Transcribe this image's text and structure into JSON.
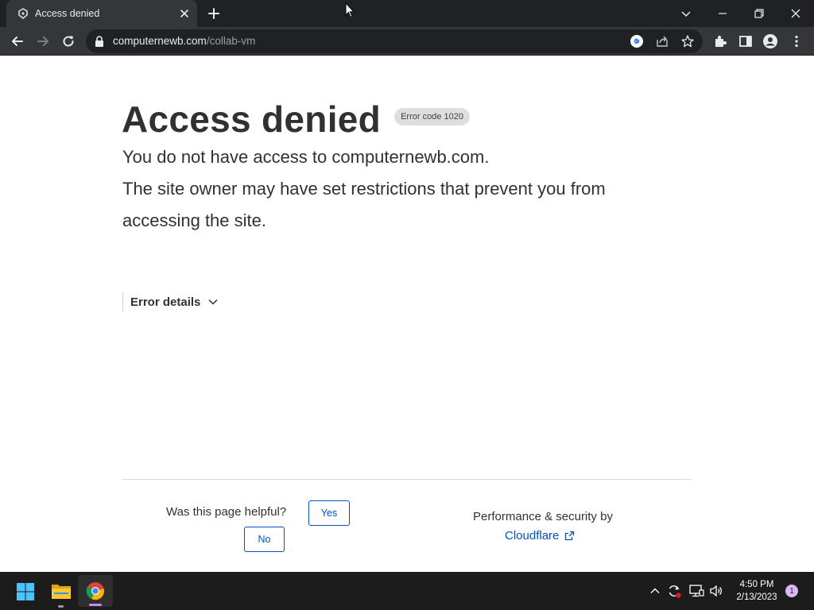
{
  "browser": {
    "tab": {
      "title": "Access denied"
    },
    "url": {
      "domain": "computernewb.com",
      "path": "/collab-vm"
    }
  },
  "page": {
    "title": "Access denied",
    "error_badge": "Error code 1020",
    "description_1": "You do not have access to computernewb.com.",
    "description_2": "The site owner may have set restrictions that prevent you from accessing the site.",
    "error_details_label": "Error details",
    "feedback": {
      "question": "Was this page helpful?",
      "yes_label": "Yes",
      "no_label": "No"
    },
    "footer": {
      "perf_text": "Performance & security by",
      "provider_link": "Cloudflare"
    },
    "link_color": "#0051c3"
  },
  "taskbar": {
    "time": "4:50 PM",
    "date": "2/13/2023",
    "notification_count": "1",
    "icons": [
      "windows-start-icon",
      "file-explorer-icon",
      "chrome-icon"
    ]
  }
}
